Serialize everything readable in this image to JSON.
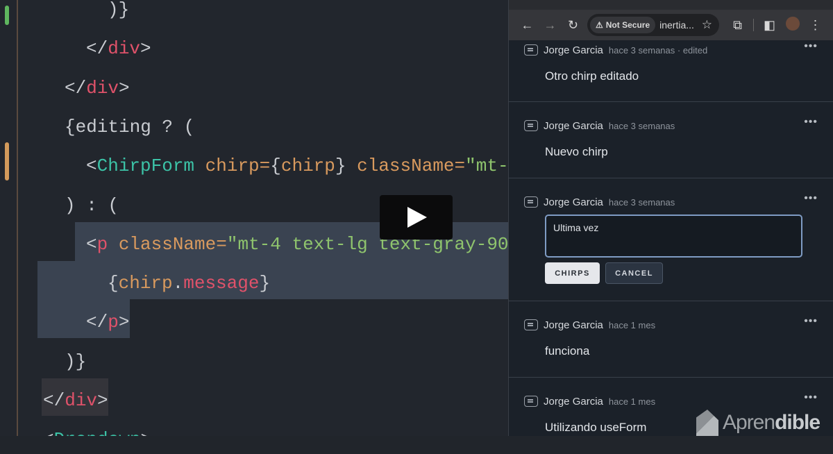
{
  "editor": {
    "lines": [
      {
        "indent": 5,
        "tokens": [
          {
            "t": ")}",
            "c": "punct"
          }
        ]
      },
      {
        "indent": 4,
        "tokens": [
          {
            "t": "</",
            "c": "punct"
          },
          {
            "t": "div",
            "c": "tag"
          },
          {
            "t": ">",
            "c": "punct"
          }
        ]
      },
      {
        "indent": 3,
        "tokens": [
          {
            "t": "</",
            "c": "punct"
          },
          {
            "t": "div",
            "c": "tag"
          },
          {
            "t": ">",
            "c": "punct"
          }
        ]
      },
      {
        "indent": 3,
        "tokens": [
          {
            "t": "{editing ? (",
            "c": "punct"
          }
        ]
      },
      {
        "indent": 4,
        "tokens": [
          {
            "t": "<",
            "c": "punct"
          },
          {
            "t": "ChirpForm",
            "c": "comp"
          },
          {
            "t": " chirp=",
            "c": "attr"
          },
          {
            "t": "{",
            "c": "punct"
          },
          {
            "t": "chirp",
            "c": "attr"
          },
          {
            "t": "} ",
            "c": "punct"
          },
          {
            "t": "className=",
            "c": "attr"
          },
          {
            "t": "\"mt-",
            "c": "str"
          }
        ]
      },
      {
        "indent": 3,
        "tokens": [
          {
            "t": ") : (",
            "c": "punct"
          }
        ]
      },
      {
        "indent": 4,
        "tokens": [
          {
            "t": "<",
            "c": "punct"
          },
          {
            "t": "p",
            "c": "tag"
          },
          {
            "t": " className=",
            "c": "attr"
          },
          {
            "t": "\"mt-4 text-lg text-gray-90",
            "c": "str"
          }
        ]
      },
      {
        "indent": 5,
        "tokens": [
          {
            "t": "{",
            "c": "punct"
          },
          {
            "t": "chirp",
            "c": "attr"
          },
          {
            "t": ".",
            "c": "punct"
          },
          {
            "t": "message",
            "c": "tag"
          },
          {
            "t": "}",
            "c": "punct"
          }
        ]
      },
      {
        "indent": 4,
        "tokens": [
          {
            "t": "</",
            "c": "punct"
          },
          {
            "t": "p",
            "c": "tag"
          },
          {
            "t": ">",
            "c": "punct"
          }
        ]
      },
      {
        "indent": 3,
        "tokens": [
          {
            "t": ")}",
            "c": "punct"
          }
        ]
      },
      {
        "indent": 2,
        "tokens": [
          {
            "t": "</",
            "c": "punct"
          },
          {
            "t": "div",
            "c": "tag"
          },
          {
            "t": ">",
            "c": "punct"
          }
        ]
      },
      {
        "indent": 2,
        "tokens": [
          {
            "t": "<",
            "c": "punct"
          },
          {
            "t": "Dropdown",
            "c": "comp"
          },
          {
            "t": ">",
            "c": "punct"
          }
        ]
      }
    ]
  },
  "browser": {
    "not_secure": "Not Secure",
    "url": "inertia..."
  },
  "chirps": [
    {
      "author": "Jorge Garcia",
      "time": "hace 3 semanas · edited",
      "message": "Otro chirp editado"
    },
    {
      "author": "Jorge Garcia",
      "time": "hace 3 semanas",
      "message": "Nuevo chirp"
    },
    {
      "author": "Jorge Garcia",
      "time": "hace 3 semanas",
      "editing": true,
      "edit_value": "Ultima vez",
      "save_label": "CHIRPS",
      "cancel_label": "CANCEL"
    },
    {
      "author": "Jorge Garcia",
      "time": "hace 1 mes",
      "message": "funciona"
    },
    {
      "author": "Jorge Garcia",
      "time": "hace 1 mes",
      "message": "Utilizando useForm"
    }
  ],
  "watermark": {
    "text_light": "Apren",
    "text_bold": "dible"
  }
}
